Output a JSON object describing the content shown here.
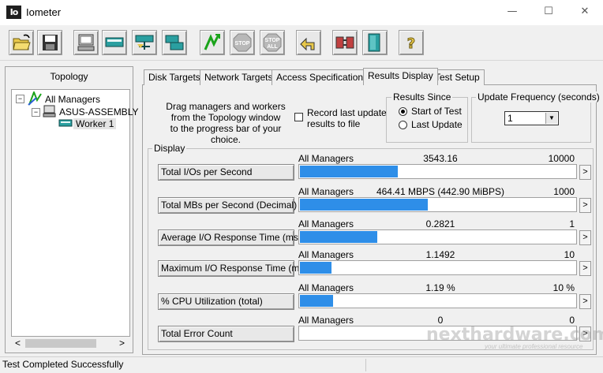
{
  "window": {
    "app_icon_text": "Io",
    "title": "Iometer",
    "minimize": "—",
    "maximize": "☐",
    "close": "✕"
  },
  "toolbar": {
    "buttons": [
      "open-icon",
      "save-icon",
      "display-icon",
      "new-worker-icon",
      "network-worker-icon",
      "duplicate-worker-icon",
      "start-icon",
      "stop-icon",
      "stop-all-icon",
      "reset-workers-icon",
      "disconnect-icon",
      "exit-icon",
      "about-icon"
    ],
    "stop_label": "STOP",
    "stop_all_label_1": "STOP",
    "stop_all_label_2": "ALL"
  },
  "topology": {
    "title": "Topology",
    "tree": [
      "All Managers",
      "ASUS-ASSEMBLY",
      "Worker 1"
    ],
    "scroll_left": "<",
    "scroll_right": ">"
  },
  "tabs": [
    "Disk Targets",
    "Network Targets",
    "Access Specifications",
    "Results Display",
    "Test Setup"
  ],
  "active_tab": "Results Display",
  "instructions": [
    "Drag managers and workers",
    "from the Topology window",
    "to the progress bar of your choice."
  ],
  "record": {
    "label_1": "Record last update",
    "label_2": "results to file",
    "checked": false
  },
  "results_since": {
    "title": "Results Since",
    "options": [
      "Start of Test",
      "Last Update"
    ],
    "selected": "Start of Test"
  },
  "update_frequency": {
    "title": "Update Frequency (seconds)",
    "value": "1",
    "dropdown_arrow": "▼"
  },
  "display": {
    "title": "Display",
    "arrow": ">",
    "metrics": [
      {
        "button": "Total I/Os per Second",
        "source": "All Managers",
        "value": "3543.16",
        "max": "10000",
        "fill": 0.354
      },
      {
        "button": "Total MBs per Second (Decimal)",
        "source": "All Managers",
        "value": "464.41 MBPS (442.90 MiBPS)",
        "max": "1000",
        "fill": 0.464
      },
      {
        "button": "Average I/O Response Time (ms)",
        "source": "All Managers",
        "value": "0.2821",
        "max": "1",
        "fill": 0.282
      },
      {
        "button": "Maximum I/O Response Time (ms)",
        "source": "All Managers",
        "value": "1.1492",
        "max": "10",
        "fill": 0.115
      },
      {
        "button": "% CPU Utilization (total)",
        "source": "All Managers",
        "value": "1.19 %",
        "max": "10 %",
        "fill": 0.119
      },
      {
        "button": "Total Error Count",
        "source": "All Managers",
        "value": "0",
        "max": "0",
        "fill": 0
      }
    ]
  },
  "status": "Test Completed Successfully",
  "watermark": {
    "main": "nexthardware.com",
    "sub": "your ultimate professional resource"
  },
  "colors": {
    "bar": "#2e8ee8",
    "accent_green": "#1aa31a"
  }
}
